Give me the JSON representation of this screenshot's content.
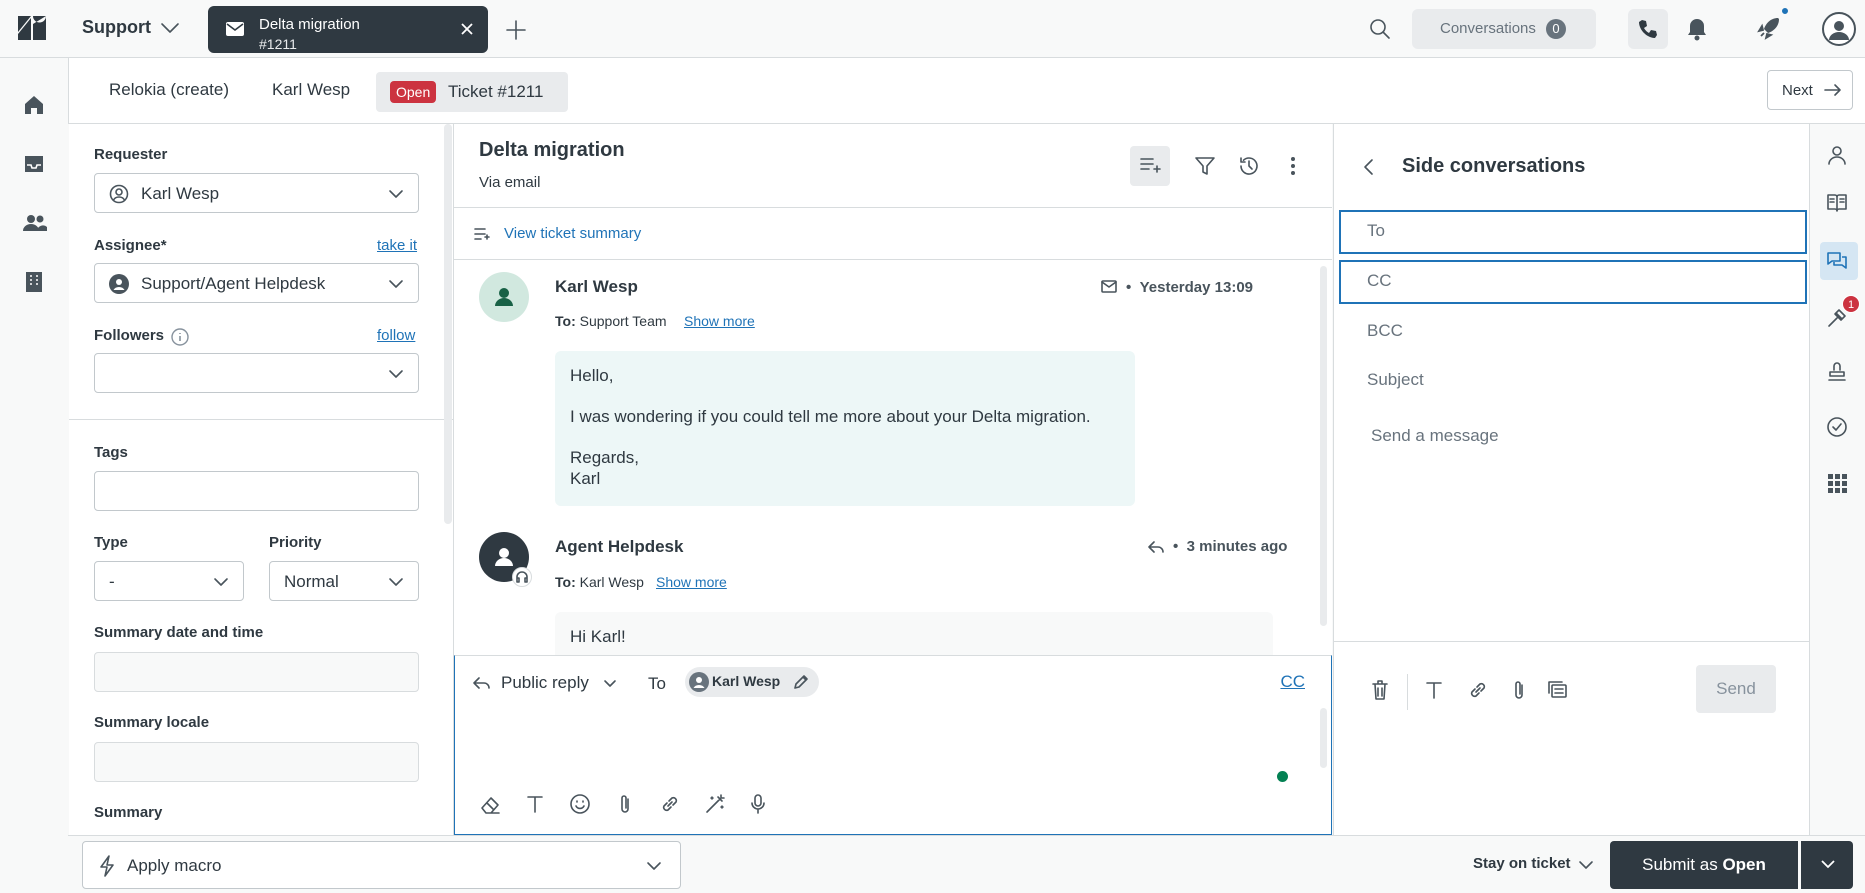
{
  "topbar": {
    "product": "Support",
    "active_tab": {
      "title": "Delta migration",
      "subtitle": "#1211"
    },
    "conversations": {
      "label": "Conversations",
      "count": "0"
    }
  },
  "subnav": {
    "crumbs": [
      "Relokia (create)",
      "Karl Wesp"
    ],
    "status": "Open",
    "ticket": "Ticket #1211",
    "next": "Next"
  },
  "properties": {
    "requester_label": "Requester",
    "requester_value": "Karl Wesp",
    "assignee_label": "Assignee*",
    "assignee_link": "take it",
    "assignee_value": "Support/Agent Helpdesk",
    "followers_label": "Followers",
    "followers_link": "follow",
    "tags_label": "Tags",
    "type_label": "Type",
    "type_value": "-",
    "priority_label": "Priority",
    "priority_value": "Normal",
    "summary_date_label": "Summary date and time",
    "summary_locale_label": "Summary locale",
    "summary_label": "Summary"
  },
  "conversation": {
    "title": "Delta migration",
    "via": "Via email",
    "summary_link": "View ticket summary",
    "messages": [
      {
        "author": "Karl Wesp",
        "time": "Yesterday 13:09",
        "to_label": "To:",
        "to": "Support Team",
        "show_more": "Show more",
        "body": [
          "Hello,",
          "I was wondering if you could tell me more about your Delta migration.",
          "Regards,",
          "Karl"
        ]
      },
      {
        "author": "Agent Helpdesk",
        "time": "3 minutes ago",
        "to_label": "To:",
        "to": "Karl Wesp",
        "show_more": "Show more",
        "body": [
          "Hi Karl!"
        ]
      }
    ]
  },
  "composer": {
    "reply_type": "Public reply",
    "to_label": "To",
    "recipient": "Karl Wesp",
    "cc": "CC"
  },
  "side_conversations": {
    "title": "Side conversations",
    "to": "To",
    "cc": "CC",
    "bcc": "BCC",
    "subject": "Subject",
    "message_placeholder": "Send a message",
    "send": "Send"
  },
  "apps": {
    "badge": "1"
  },
  "bottombar": {
    "macro": "Apply macro",
    "stay": "Stay on ticket",
    "submit_prefix": "Submit as",
    "submit_status": "Open"
  },
  "colors": {
    "brand_dark": "#2f3941",
    "link": "#1f73b7",
    "open_status": "#cc3340",
    "customer_bubble": "#edf7f7",
    "online": "#038153"
  },
  "icons": [
    "zendesk-logo-icon",
    "chevron-down-icon",
    "mail-icon",
    "close-icon",
    "plus-icon",
    "search-icon",
    "phone-icon",
    "bell-icon",
    "rocket-icon",
    "user-avatar-icon",
    "home-icon",
    "inbox-icon",
    "users-icon",
    "building-icon",
    "arrow-right-icon",
    "info-icon",
    "summary-icon",
    "filter-icon",
    "history-icon",
    "more-icon",
    "reply-icon",
    "pencil-icon",
    "eraser-icon",
    "text-format-icon",
    "emoji-icon",
    "paperclip-icon",
    "link-icon",
    "magic-wand-icon",
    "microphone-icon",
    "chevron-left-icon",
    "trash-icon",
    "copy-icon",
    "book-icon",
    "chat-icon",
    "stamp-icon",
    "check-circle-icon",
    "grid-icon",
    "bolt-icon"
  ]
}
